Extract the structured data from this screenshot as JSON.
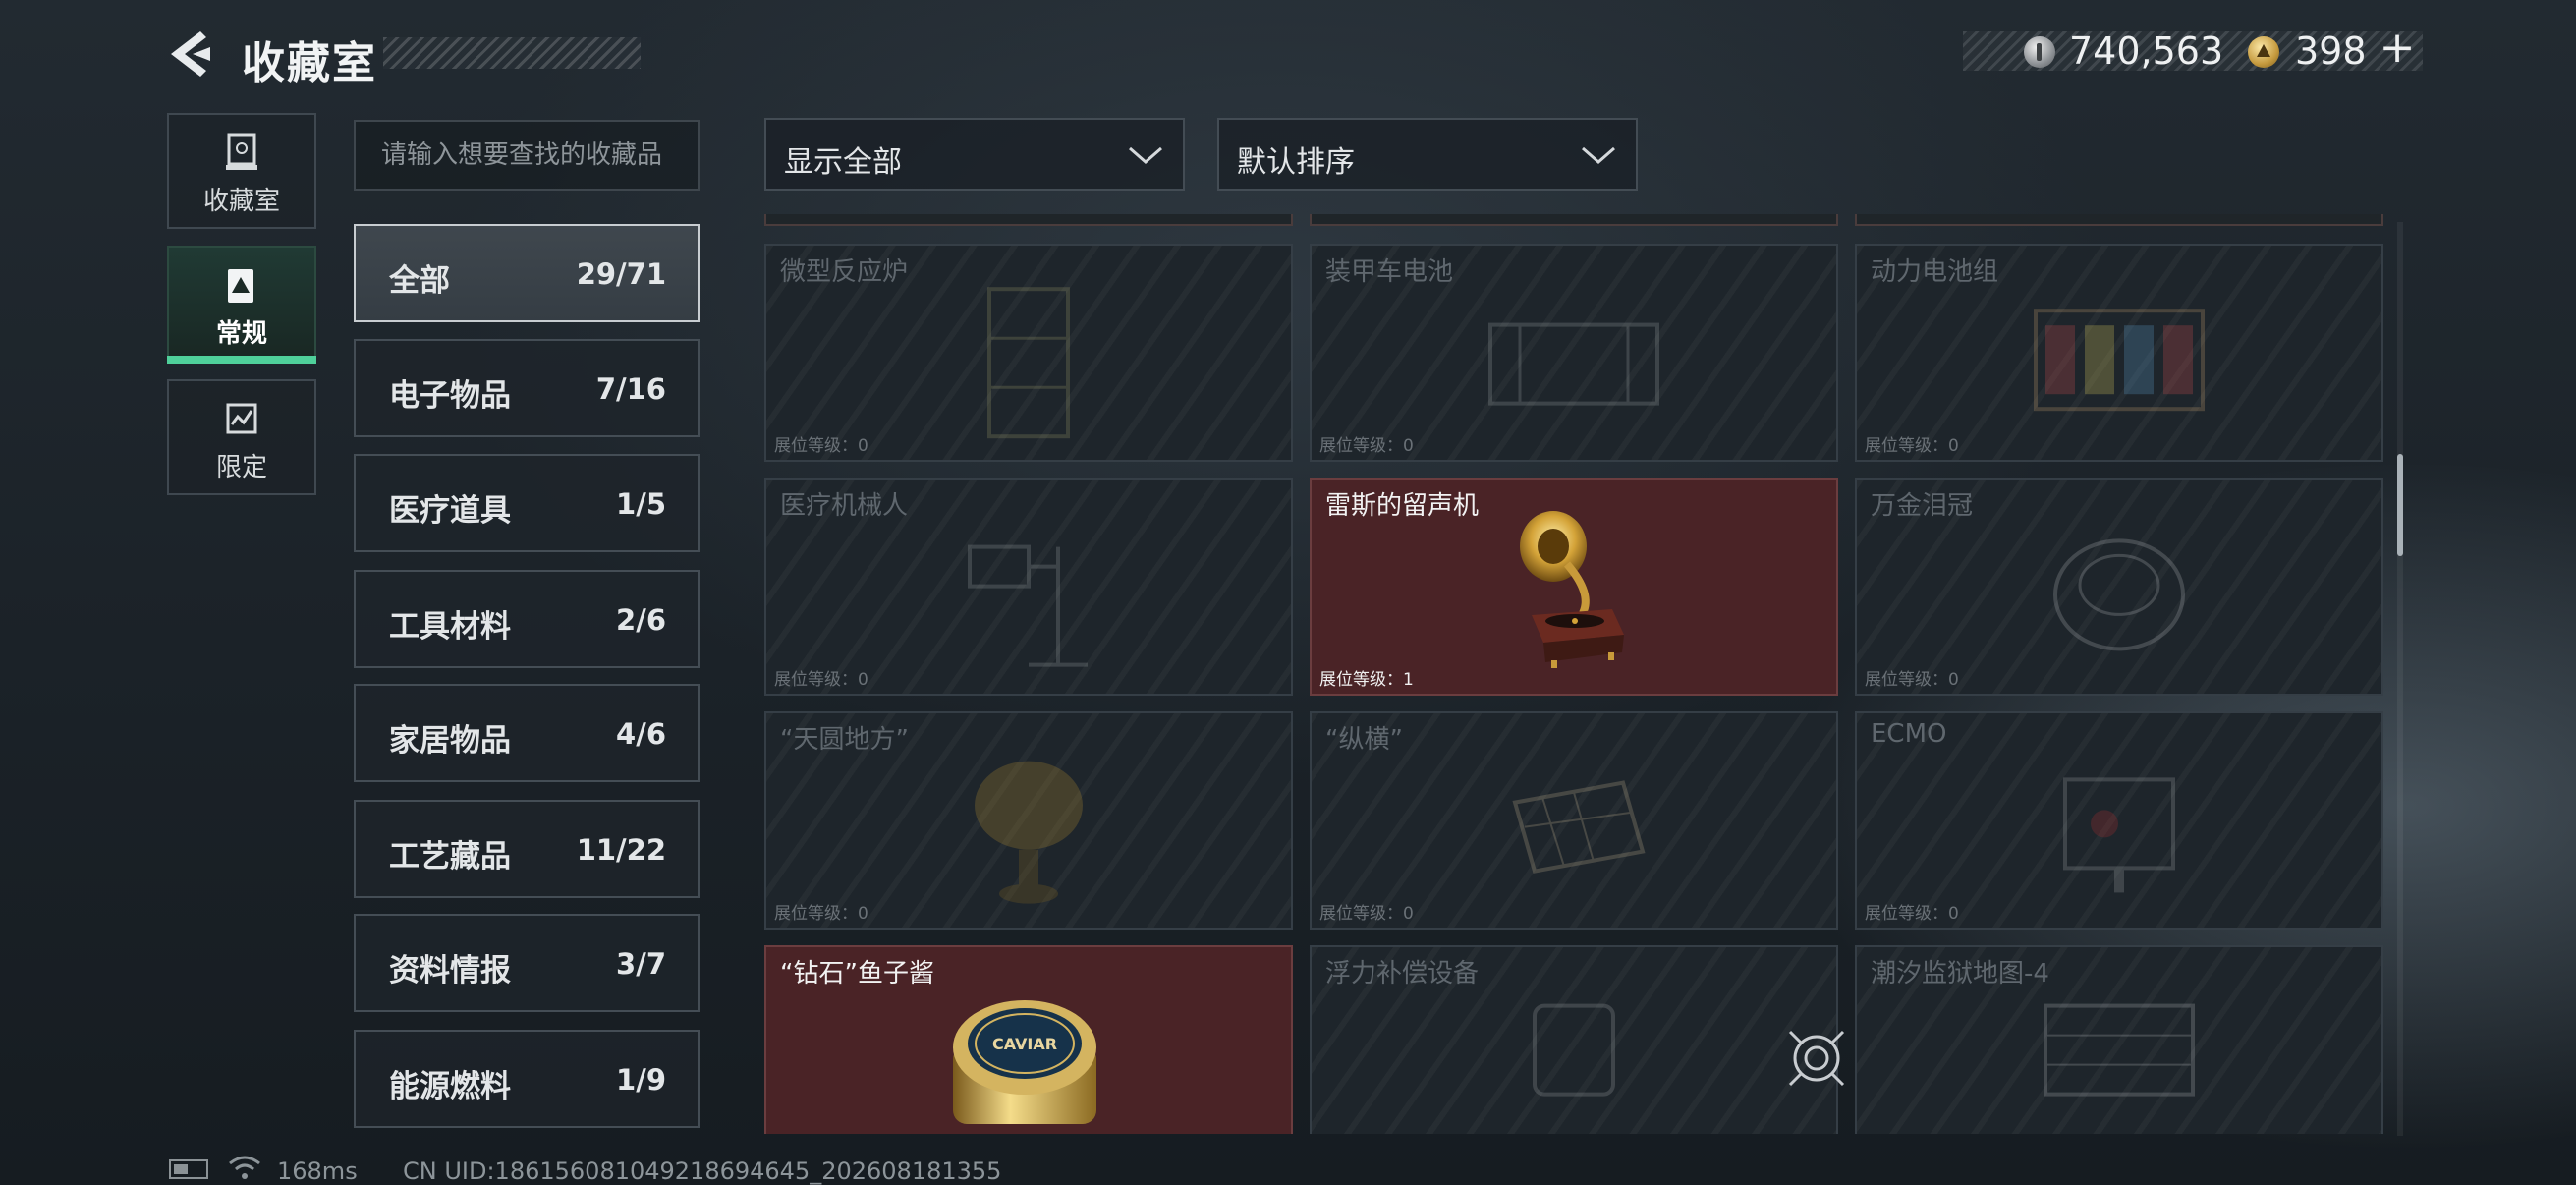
{
  "header": {
    "title": "收藏室",
    "silver_amount": "740,563",
    "gold_amount": "398",
    "add_label": "+"
  },
  "nav": {
    "collection_label": "收藏室",
    "regular_label": "常规",
    "limited_label": "限定"
  },
  "search": {
    "placeholder": "请输入想要查找的收藏品"
  },
  "categories": [
    {
      "name": "全部",
      "count": "29/71"
    },
    {
      "name": "电子物品",
      "count": "7/16"
    },
    {
      "name": "医疗道具",
      "count": "1/5"
    },
    {
      "name": "工具材料",
      "count": "2/6"
    },
    {
      "name": "家居物品",
      "count": "4/6"
    },
    {
      "name": "工艺藏品",
      "count": "11/22"
    },
    {
      "name": "资料情报",
      "count": "3/7"
    },
    {
      "name": "能源燃料",
      "count": "1/9"
    }
  ],
  "filters": {
    "display": "显示全部",
    "sort": "默认排序"
  },
  "items": [
    {
      "name": "微型反应炉",
      "level": "展位等级：0",
      "owned": false
    },
    {
      "name": "装甲车电池",
      "level": "展位等级：0",
      "owned": false
    },
    {
      "name": "动力电池组",
      "level": "展位等级：0",
      "owned": false
    },
    {
      "name": "医疗机械人",
      "level": "展位等级：0",
      "owned": false
    },
    {
      "name": "雷斯的留声机",
      "level": "展位等级：1",
      "owned": true
    },
    {
      "name": "万金泪冠",
      "level": "展位等级：0",
      "owned": false
    },
    {
      "name": "“天圆地方”",
      "level": "展位等级：0",
      "owned": false
    },
    {
      "name": "“纵横”",
      "level": "展位等级：0",
      "owned": false
    },
    {
      "name": "ECMO",
      "level": "展位等级：0",
      "owned": false
    },
    {
      "name": "“钻石”鱼子酱",
      "level": "",
      "owned": true,
      "label_text": "CAVIAR"
    },
    {
      "name": "浮力补偿设备",
      "level": "",
      "owned": false
    },
    {
      "name": "潮汐监狱地图-4",
      "level": "",
      "owned": false
    }
  ],
  "footer": {
    "ping": "168ms",
    "uid": "CN UID:1861560810492186946​45_202608181355"
  },
  "colors": {
    "accent_green": "#4fd09a",
    "owned_red": "#4a2326",
    "panel": "#1e252b"
  }
}
